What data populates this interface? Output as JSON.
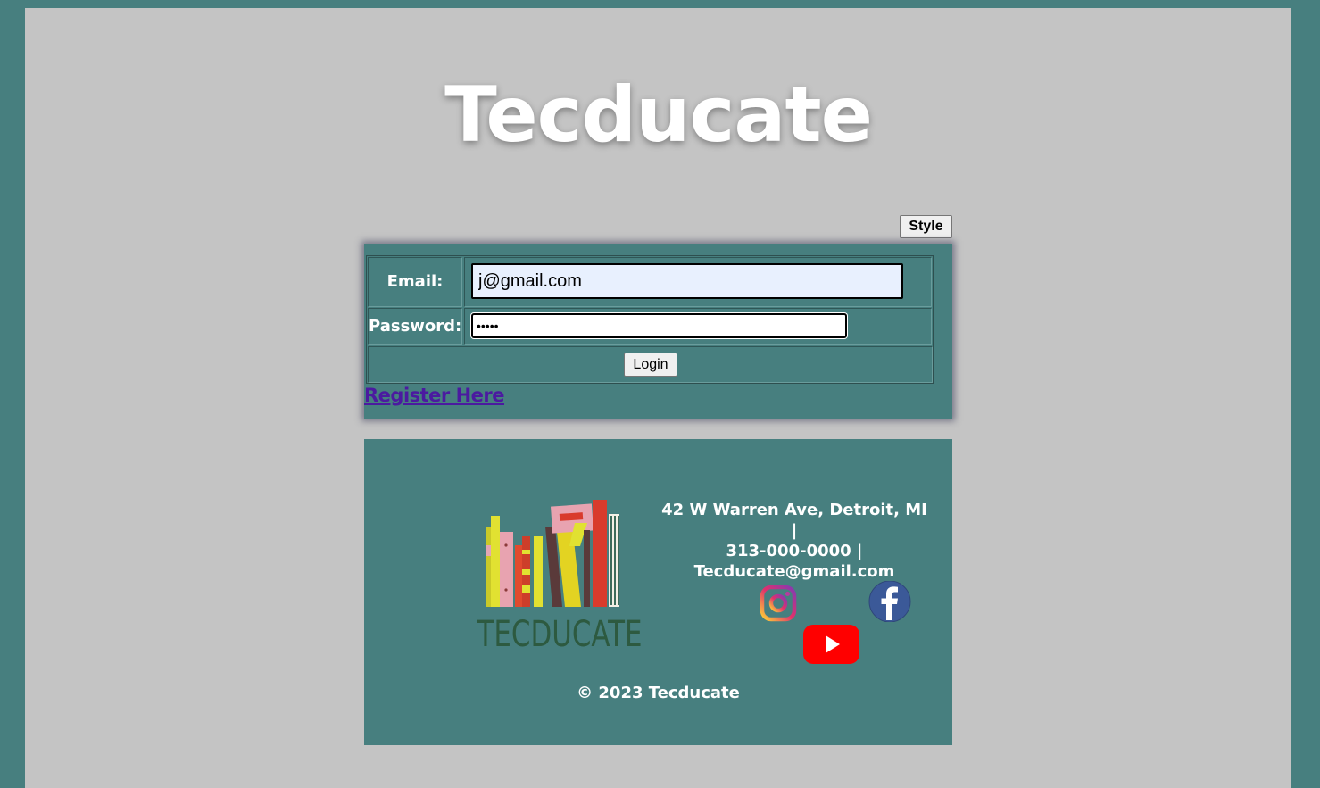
{
  "site": {
    "title": "Tecducate"
  },
  "toolbar": {
    "style_label": "Style"
  },
  "login_form": {
    "email_label": "Email:",
    "email_value": "j@gmail.com",
    "password_label": "Password:",
    "password_value": "•••••",
    "login_label": "Login",
    "register_label": "Register Here"
  },
  "footer": {
    "logo_text": "TECDUCATE",
    "contact_line1": "42 W Warren Ave, Detroit, MI |",
    "contact_line2": "313-000-0000 |",
    "contact_line3": "Tecducate@gmail.com",
    "social_icons": [
      "instagram-icon",
      "facebook-icon",
      "youtube-icon"
    ],
    "copyright": "© 2023 Tecducate"
  },
  "colors": {
    "page_border": "#477f7f",
    "page_background": "#c4c4c4",
    "panel_background": "#477f7f",
    "link": "#4b1aa0",
    "youtube_red": "#ff0000",
    "facebook_blue": "#3b5998"
  }
}
